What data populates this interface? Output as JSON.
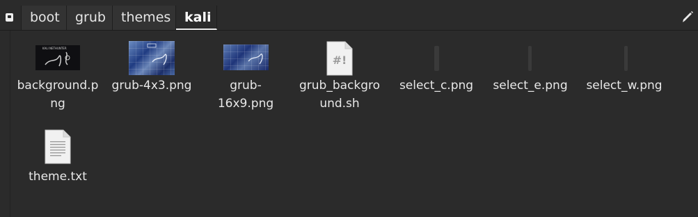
{
  "pathbar": {
    "crumbs": [
      "boot",
      "grub",
      "themes",
      "kali"
    ],
    "active_index": 3
  },
  "icons": {
    "drive": "drive-icon",
    "edit": "pencil-icon"
  },
  "files": [
    {
      "name": "background.png",
      "label_line1": "background.p",
      "label_line2": "ng",
      "kind": "image-thumbnail"
    },
    {
      "name": "grub-4x3.png",
      "kind": "image-thumbnail"
    },
    {
      "name": "grub-16x9.png",
      "kind": "image-thumbnail"
    },
    {
      "name": "grub_background.sh",
      "label_line1": "grub_backgro",
      "label_line2": "und.sh",
      "kind": "script-icon",
      "icon_text": "#!"
    },
    {
      "name": "select_c.png",
      "kind": "image-thumbnail"
    },
    {
      "name": "select_e.png",
      "kind": "image-thumbnail"
    },
    {
      "name": "select_w.png",
      "kind": "image-thumbnail"
    },
    {
      "name": "theme.txt",
      "kind": "text-icon"
    }
  ],
  "thumbnail_text": {
    "background": "KALI   NETHUNTER"
  },
  "colors": {
    "window_bg": "#2b2b2b",
    "crumb_bg": "#333333",
    "text": "#e8e8e8",
    "active_underline": "#ededed"
  }
}
